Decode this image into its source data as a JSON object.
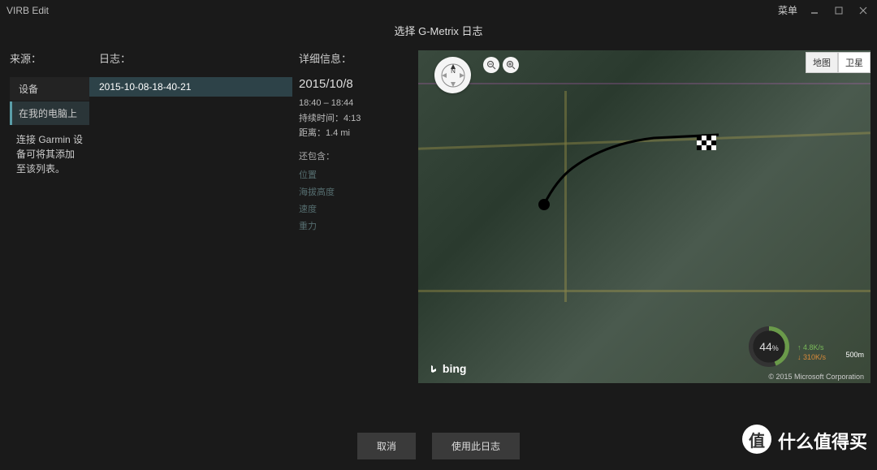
{
  "titlebar": {
    "title": "VIRB Edit",
    "menu": "菜单"
  },
  "subtitle": "选择 G-Metrix 日志",
  "source": {
    "header": "来源：",
    "items": [
      {
        "label": "设备"
      },
      {
        "label": "在我的电脑上"
      }
    ],
    "help": "连接 Garmin 设备可将其添加至该列表。"
  },
  "log": {
    "header": "日志：",
    "item": "2015-10-08-18-40-21"
  },
  "details": {
    "header": "详细信息：",
    "date": "2015/10/8",
    "time": "18:40 – 18:44",
    "duration_label": "持续时间：",
    "duration_value": "4:13",
    "distance_label": "距离：",
    "distance_value": "1.4 mi",
    "includes": "还包含：",
    "fields": [
      "位置",
      "海拔高度",
      "速度",
      "重力"
    ]
  },
  "map": {
    "compass": "N",
    "type_map": "地图",
    "type_sat": "卫星",
    "bing": "bing",
    "copyright": "© 2015 Microsoft Corporation",
    "battery": "44",
    "battery_unit": "%",
    "speed_up": "4.8K/s",
    "speed_down": "310K/s",
    "scale": "500m"
  },
  "actions": {
    "cancel": "取消",
    "use": "使用此日志"
  },
  "watermark": {
    "logo": "值",
    "text": "什么值得买"
  }
}
